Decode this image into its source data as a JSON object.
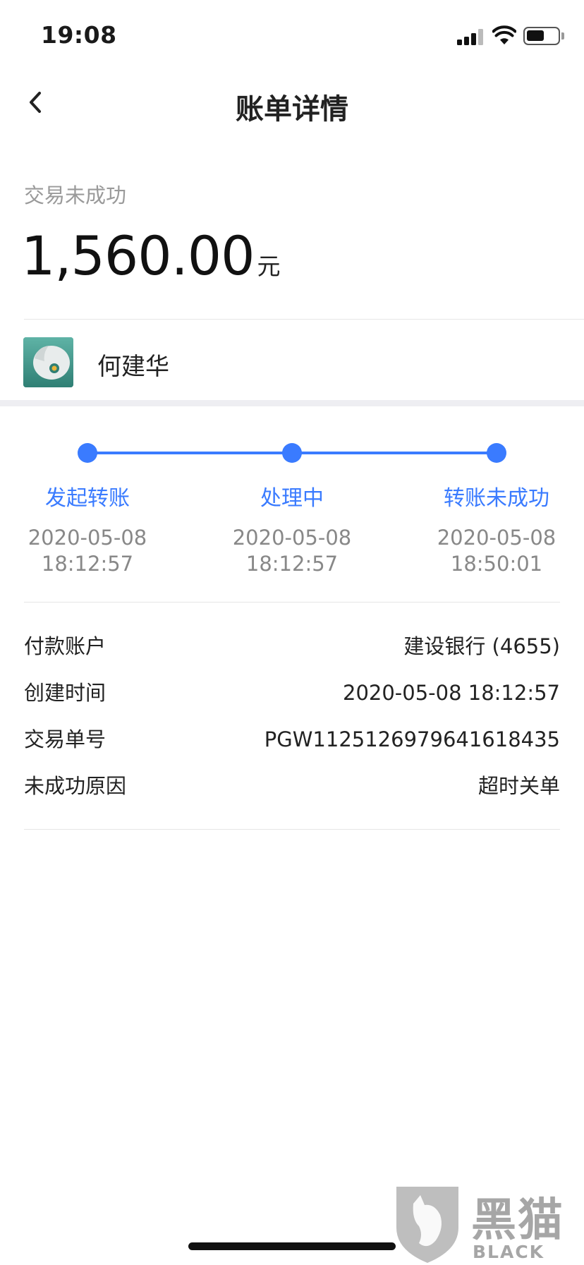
{
  "status_bar": {
    "time": "19:08"
  },
  "nav": {
    "title": "账单详情"
  },
  "transaction": {
    "status": "交易未成功",
    "amount": "1,560.00",
    "unit": "元"
  },
  "payee": {
    "name": "何建华"
  },
  "progress": {
    "steps": [
      {
        "label": "发起转账",
        "date": "2020-05-08",
        "time": "18:12:57"
      },
      {
        "label": "处理中",
        "date": "2020-05-08",
        "time": "18:12:57"
      },
      {
        "label": "转账未成功",
        "date": "2020-05-08",
        "time": "18:50:01"
      }
    ]
  },
  "details": [
    {
      "label": "付款账户",
      "value": "建设银行 (4655)"
    },
    {
      "label": "创建时间",
      "value": "2020-05-08 18:12:57"
    },
    {
      "label": "交易单号",
      "value": "PGW1125126979641618435"
    },
    {
      "label": "未成功原因",
      "value": "超时关单"
    }
  ],
  "watermark": {
    "brand_cn": "黑猫",
    "brand_en": "BLACK CAT"
  },
  "colors": {
    "accent": "#3a7bff",
    "muted": "#9a9a9a",
    "divider": "#e6e6e6"
  }
}
